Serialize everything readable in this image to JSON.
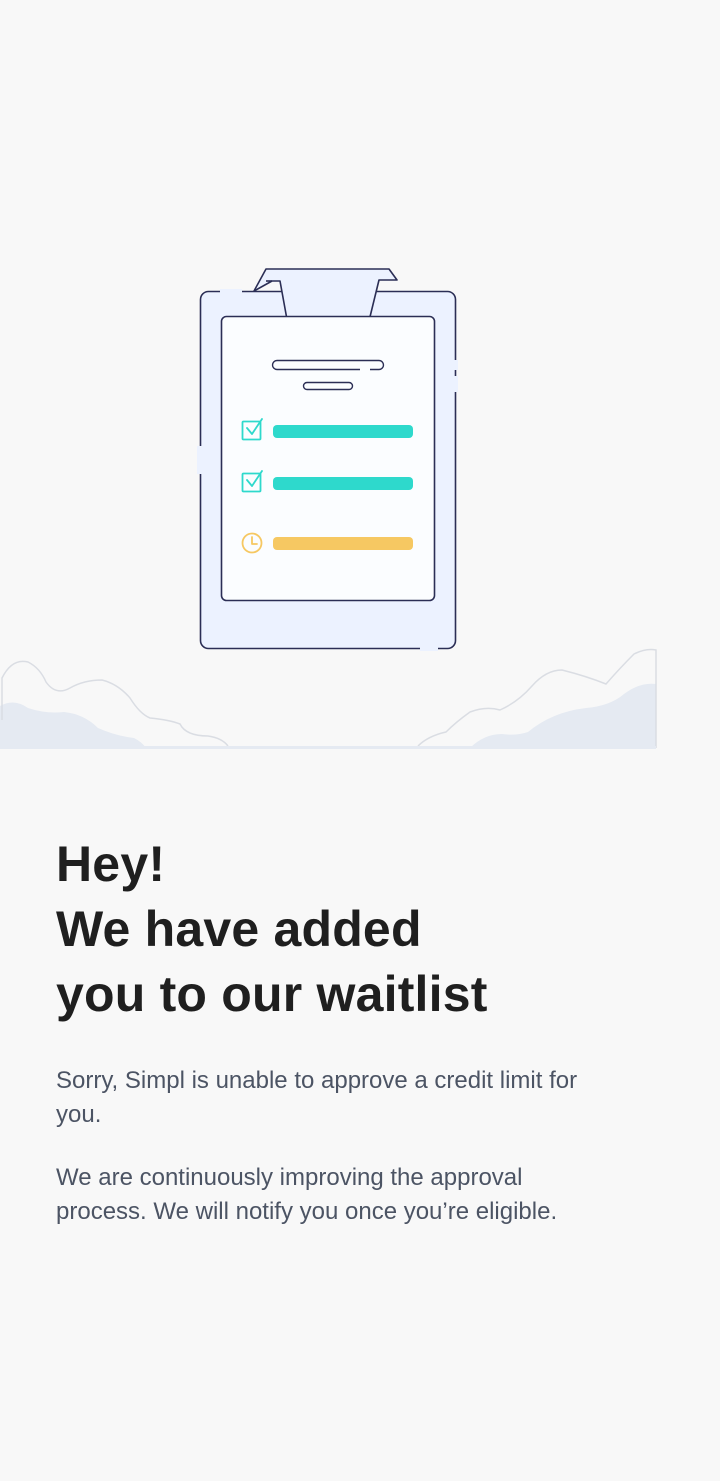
{
  "heading": {
    "line1": "Hey!",
    "line2": "We have added",
    "line3": "you to our waitlist"
  },
  "message": {
    "rejection": "Sorry, Simpl is unable to approve a credit limit for you.",
    "followup": "We are continuously improving the approval process. We will notify you once you’re eligible."
  },
  "illustration": {
    "checklist_items": [
      {
        "status": "done",
        "icon": "checkbox-checked-icon",
        "color": "#2ed9cc"
      },
      {
        "status": "done",
        "icon": "checkbox-checked-icon",
        "color": "#2ed9cc"
      },
      {
        "status": "pending",
        "icon": "clock-icon",
        "color": "#f6c862"
      }
    ],
    "colors": {
      "outline": "#2b2e55",
      "board": "#ecf2ff",
      "paper": "#fbfdff",
      "clouds": "#e5eaf2"
    }
  }
}
